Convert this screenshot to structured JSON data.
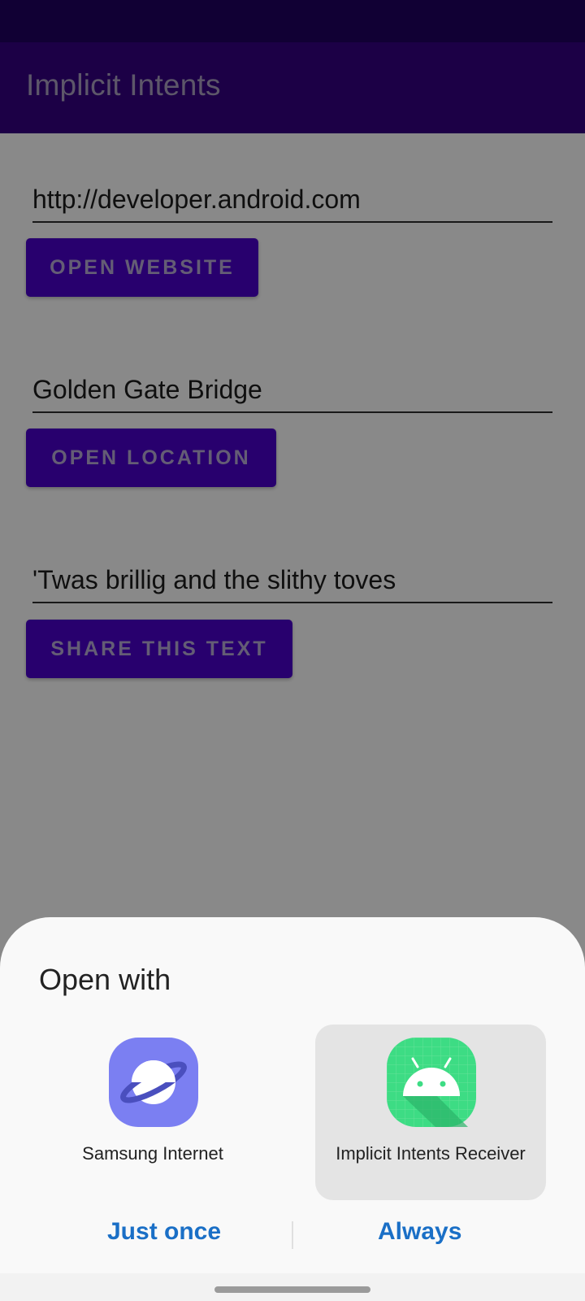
{
  "app_bar": {
    "title": "Implicit Intents"
  },
  "fields": [
    {
      "value": "http://developer.android.com",
      "button": "OPEN WEBSITE"
    },
    {
      "value": "Golden Gate Bridge",
      "button": "OPEN LOCATION"
    },
    {
      "value": "'Twas brillig and the slithy toves",
      "button": "SHARE THIS TEXT"
    }
  ],
  "sheet": {
    "title": "Open with",
    "apps": [
      {
        "label": "Samsung Internet",
        "icon": "samsung-internet-icon",
        "selected": false
      },
      {
        "label": "Implicit Intents Receiver",
        "icon": "android-app-icon",
        "selected": true
      }
    ],
    "actions": {
      "just_once": "Just once",
      "always": "Always"
    }
  },
  "colors": {
    "status_bar": "#1f0060",
    "app_bar": "#330080",
    "button": "#4a00c8",
    "action_text": "#1a6fc6"
  }
}
